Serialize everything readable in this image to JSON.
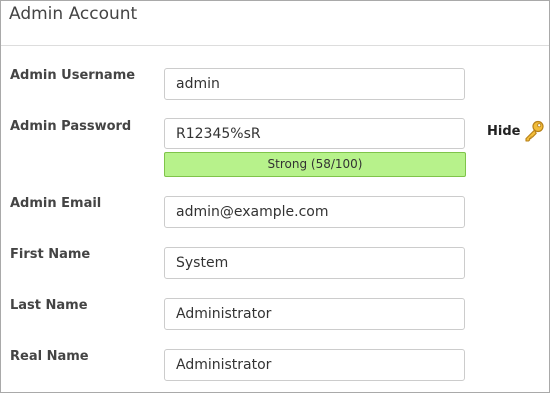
{
  "section": {
    "title": "Admin Account"
  },
  "fields": {
    "username": {
      "label": "Admin Username",
      "value": "admin"
    },
    "password": {
      "label": "Admin Password",
      "value": "R12345%sR",
      "strength_text": "Strong (58/100)",
      "strength_score": 58,
      "toggle_label": "Hide"
    },
    "email": {
      "label": "Admin Email",
      "value": "admin@example.com"
    },
    "first_name": {
      "label": "First Name",
      "value": "System"
    },
    "last_name": {
      "label": "Last Name",
      "value": "Administrator"
    },
    "real_name": {
      "label": "Real Name",
      "value": "Administrator"
    }
  },
  "colors": {
    "strength_bar": "#b7f28b",
    "strength_border": "#7fc44a",
    "key_icon": "#e5a71b"
  },
  "icons": {
    "password_toggle": "key-icon"
  }
}
